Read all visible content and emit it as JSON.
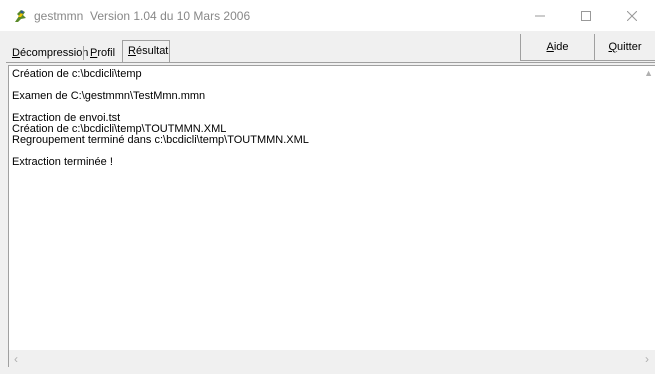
{
  "window": {
    "title": "gestmmn  Version 1.04 du 10 Mars 2006",
    "app_icon": "gestmmn-app-icon",
    "controls": {
      "minimize_icon": "minimize-icon",
      "maximize_icon": "maximize-icon",
      "close_icon": "close-icon"
    }
  },
  "tabs": [
    {
      "label": "Décompression",
      "accel": "D",
      "rest": "écompression",
      "active": false
    },
    {
      "label": "Profil",
      "accel": "P",
      "rest": "rofil",
      "active": false
    },
    {
      "label": "Résultat",
      "accel": "R",
      "rest": "ésultat",
      "active": true
    }
  ],
  "toolbar": {
    "aide": {
      "accel": "A",
      "rest": "ide",
      "label": "Aide"
    },
    "quitter": {
      "accel": "Q",
      "rest": "uitter",
      "label": "Quitter"
    }
  },
  "output": {
    "lines": [
      "Création de c:\\bcdicli\\temp",
      "",
      "Examen de C:\\gestmmn\\TestMmn.mmn",
      "",
      "Extraction de envoi.tst",
      "Création de c:\\bcdicli\\temp\\TOUTMMN.XML",
      "Regroupement terminé dans c:\\bcdicli\\temp\\TOUTMMN.XML",
      "",
      "Extraction terminée !"
    ]
  },
  "scrollbar": {
    "left_icon": "scroll-left-arrow-icon",
    "right_icon": "scroll-right-arrow-icon"
  }
}
